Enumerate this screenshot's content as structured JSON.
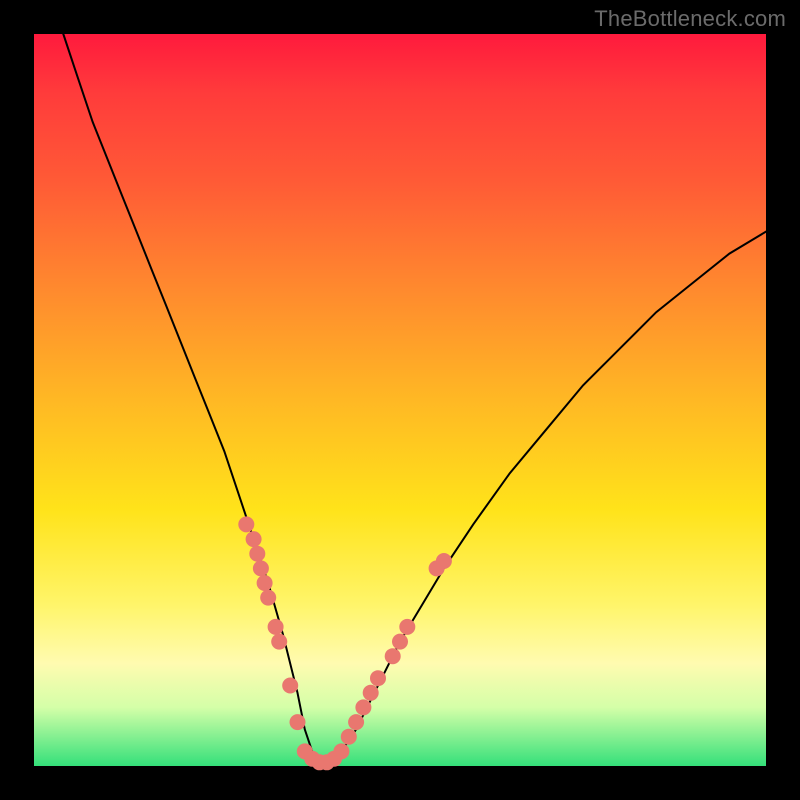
{
  "watermark": "TheBottleneck.com",
  "chart_data": {
    "type": "line",
    "title": "",
    "xlabel": "",
    "ylabel": "",
    "xlim": [
      0,
      100
    ],
    "ylim": [
      0,
      100
    ],
    "grid": false,
    "series": [
      {
        "name": "curve",
        "x": [
          4,
          6,
          8,
          10,
          12,
          14,
          16,
          18,
          20,
          22,
          24,
          26,
          28,
          30,
          32,
          34,
          36,
          37,
          38,
          39,
          40,
          42,
          44,
          46,
          48,
          50,
          53,
          56,
          60,
          65,
          70,
          75,
          80,
          85,
          90,
          95,
          100
        ],
        "y": [
          100,
          94,
          88,
          83,
          78,
          73,
          68,
          63,
          58,
          53,
          48,
          43,
          37,
          31,
          25,
          18,
          10,
          5,
          2,
          0.5,
          0.5,
          2,
          5,
          9,
          13,
          17,
          22,
          27,
          33,
          40,
          46,
          52,
          57,
          62,
          66,
          70,
          73
        ],
        "color": "#000000",
        "width": 2
      }
    ],
    "markers": {
      "name": "data-points",
      "color": "#e9776f",
      "radius": 8,
      "points": [
        {
          "x": 29,
          "y": 33
        },
        {
          "x": 30,
          "y": 31
        },
        {
          "x": 30.5,
          "y": 29
        },
        {
          "x": 31,
          "y": 27
        },
        {
          "x": 31.5,
          "y": 25
        },
        {
          "x": 32,
          "y": 23
        },
        {
          "x": 33,
          "y": 19
        },
        {
          "x": 33.5,
          "y": 17
        },
        {
          "x": 35,
          "y": 11
        },
        {
          "x": 36,
          "y": 6
        },
        {
          "x": 37,
          "y": 2
        },
        {
          "x": 38,
          "y": 1
        },
        {
          "x": 39,
          "y": 0.5
        },
        {
          "x": 40,
          "y": 0.5
        },
        {
          "x": 41,
          "y": 1
        },
        {
          "x": 42,
          "y": 2
        },
        {
          "x": 43,
          "y": 4
        },
        {
          "x": 44,
          "y": 6
        },
        {
          "x": 45,
          "y": 8
        },
        {
          "x": 46,
          "y": 10
        },
        {
          "x": 47,
          "y": 12
        },
        {
          "x": 49,
          "y": 15
        },
        {
          "x": 50,
          "y": 17
        },
        {
          "x": 51,
          "y": 19
        },
        {
          "x": 55,
          "y": 27
        },
        {
          "x": 56,
          "y": 28
        }
      ]
    },
    "background_gradient": {
      "type": "vertical",
      "stops": [
        {
          "pos": 0,
          "color": "#ff1a3d"
        },
        {
          "pos": 50,
          "color": "#ffb824"
        },
        {
          "pos": 78,
          "color": "#fff56a"
        },
        {
          "pos": 100,
          "color": "#34e07a"
        }
      ]
    }
  }
}
